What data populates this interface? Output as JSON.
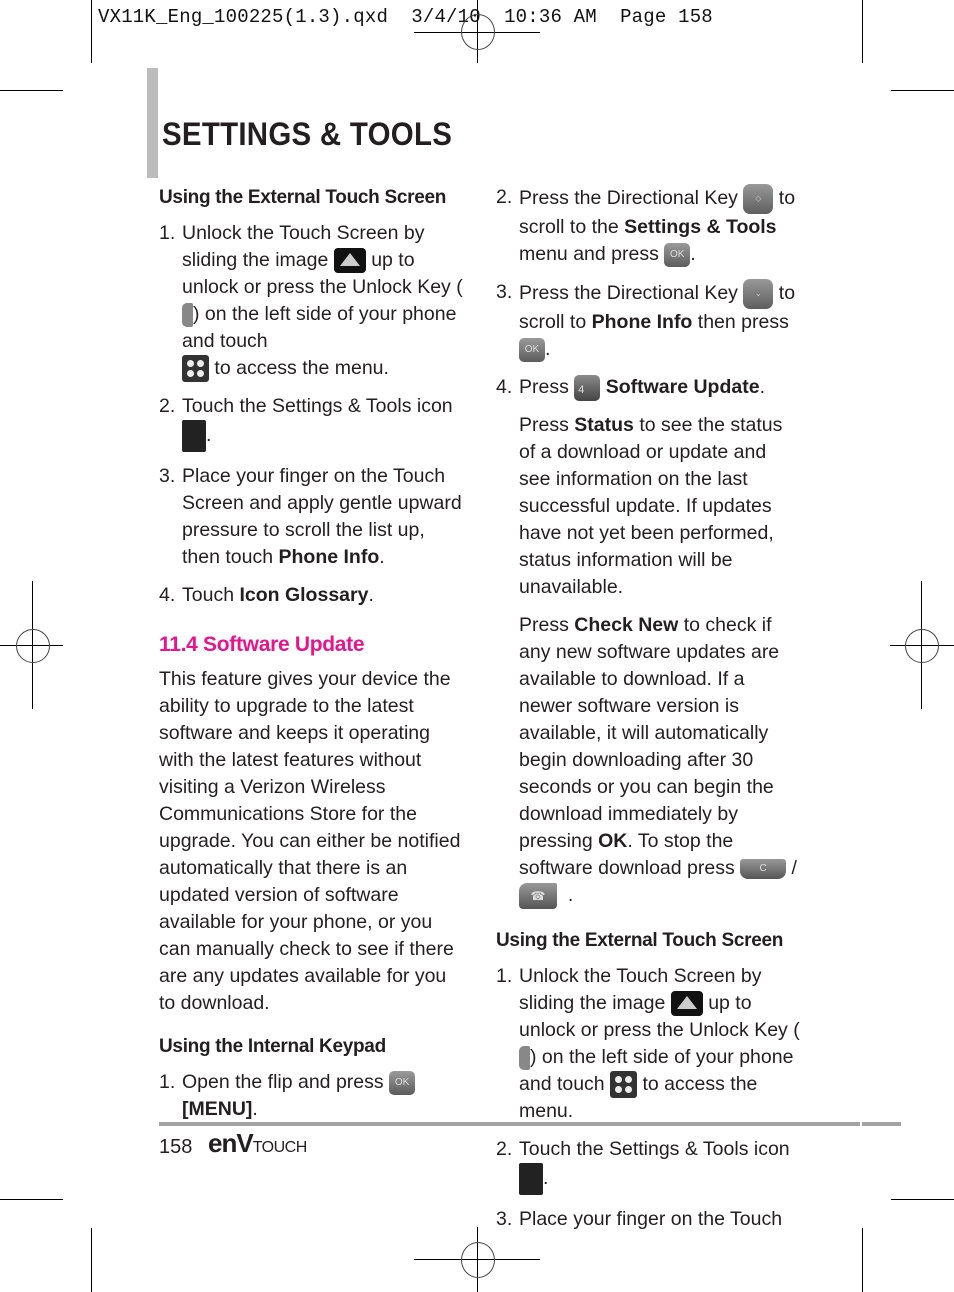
{
  "print_slug": "VX11K_Eng_100225(1.3).qxd  3/4/10  10:36 AM  Page 158",
  "page_title": "SETTINGS & TOOLS",
  "left_column": {
    "external_heading": "Using the External Touch Screen",
    "step1": {
      "num": "1.",
      "a": "Unlock the Touch Screen by sliding the image",
      "b": "up to unlock or press the Unlock Key (",
      "c": ") on the left side of your phone and touch",
      "d": "to access the menu."
    },
    "step2": {
      "num": "2.",
      "a": "Touch the Settings & Tools icon",
      "b": "."
    },
    "step3": {
      "num": "3.",
      "a": "Place your finger on the Touch Screen and apply gentle upward pressure to scroll the list up, then touch",
      "bold": "Phone Info",
      "b": "."
    },
    "step4": {
      "num": "4.",
      "a": "Touch",
      "bold": "Icon Glossary",
      "b": "."
    },
    "section_heading": "11.4 Software Update",
    "section_body": "This feature gives your device the ability to upgrade to the latest software and keeps it operating with the latest features without visiting a Verizon Wireless Communications Store for the upgrade. You can either be notified automatically that there is an updated version of software available for your phone, or you can manually check to see if there are any updates available for you to download.",
    "internal_heading": "Using the Internal Keypad",
    "istep1": {
      "num": "1.",
      "a": "Open the flip and press",
      "bold": "[MENU]",
      "b": "."
    }
  },
  "right_column": {
    "step2": {
      "num": "2.",
      "a": "Press the Directional Key",
      "b": "to scroll to the",
      "bold": "Settings & Tools",
      "c": "menu and press",
      "d": "."
    },
    "step3": {
      "num": "3.",
      "a": "Press the Directional Key",
      "b": "to scroll to",
      "bold": "Phone Info",
      "c": "then press",
      "d": "."
    },
    "step4": {
      "num": "4.",
      "a": "Press",
      "bold": "Software Update",
      "b": "."
    },
    "status_para": {
      "a": "Press",
      "bold": "Status",
      "b": "to see the status of a download or update and see information on the last successful update. If updates have not yet been performed, status information will be unavailable."
    },
    "checknew_para": {
      "a": "Press",
      "bold": "Check New",
      "b": "to check if any new software updates are available to download. If a newer software version is available, it will automatically begin downloading after 30 seconds or you can begin the download immediately by pressing",
      "bold2": "OK",
      "c": ". To stop the software download press",
      "sep": "/",
      "d": "."
    },
    "external_heading": "Using the External Touch Screen",
    "step1": {
      "num": "1.",
      "a": "Unlock the Touch Screen by sliding the image",
      "b": "up to unlock or press the Unlock Key (",
      "c": ") on the left side of your phone and touch",
      "d": "to access the menu."
    },
    "step2b": {
      "num": "2.",
      "a": "Touch the Settings & Tools icon",
      "b": "."
    },
    "step3b": {
      "num": "3.",
      "a": "Place your finger on the Touch"
    }
  },
  "icons": {
    "ok_label": "OK",
    "settings_label": "Settings & Tools",
    "four_label": "4",
    "clear_label": "C",
    "end_label": "☎"
  },
  "footer": {
    "page_number": "158",
    "brand_env": "enV",
    "brand_touch": "TOUCH"
  }
}
